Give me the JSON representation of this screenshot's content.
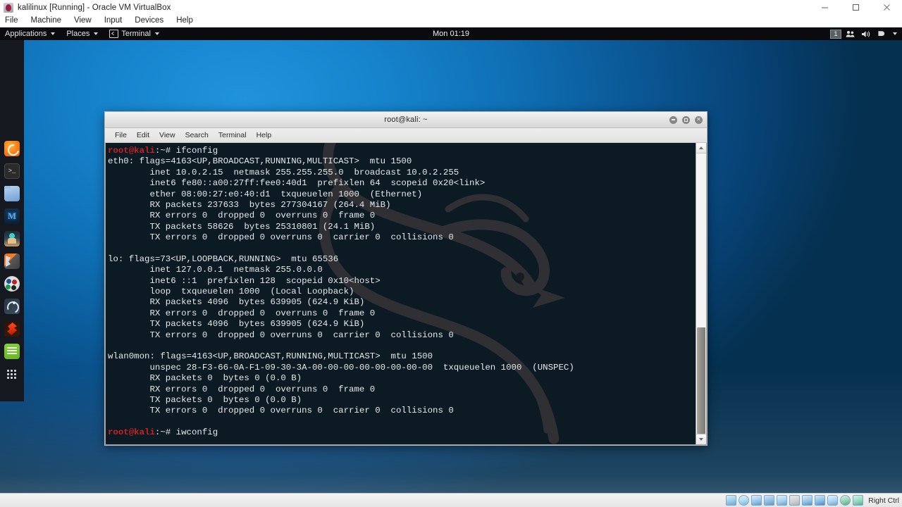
{
  "host_window": {
    "title": "kalilinux [Running] - Oracle VM VirtualBox",
    "app_icon": "virtualbox-icon",
    "controls": {
      "minimize": "minimize-icon",
      "maximize": "maximize-icon",
      "close": "close-icon"
    },
    "menu": [
      "File",
      "Machine",
      "View",
      "Input",
      "Devices",
      "Help"
    ]
  },
  "guest_panel": {
    "applications_label": "Applications",
    "places_label": "Places",
    "terminal_label": "Terminal",
    "clock": "Mon 01:19",
    "workspace": "1",
    "tray_icons": [
      "users-icon",
      "volume-icon",
      "power-icon",
      "chevron-down-icon"
    ]
  },
  "dock": {
    "items": [
      {
        "name": "firefox",
        "label": "Firefox ESR",
        "class": "di-firefox",
        "running": true
      },
      {
        "name": "terminal",
        "label": "Terminal",
        "class": "di-terminal",
        "running": true
      },
      {
        "name": "files",
        "label": "Files",
        "class": "di-files",
        "running": false
      },
      {
        "name": "metasploit",
        "label": "Metasploit Framework",
        "class": "di-metasploit",
        "running": false
      },
      {
        "name": "armitage",
        "label": "Armitage",
        "class": "di-armitage",
        "running": false
      },
      {
        "name": "burpsuite",
        "label": "Burp Suite",
        "class": "di-burp",
        "running": false
      },
      {
        "name": "beef",
        "label": "BeEF",
        "class": "di-beef",
        "running": false
      },
      {
        "name": "maltego",
        "label": "Maltego",
        "class": "di-maltego",
        "running": false
      },
      {
        "name": "faraday",
        "label": "Faraday IDE",
        "class": "di-flame",
        "running": false
      },
      {
        "name": "text-editor",
        "label": "Text Editor",
        "class": "di-notes",
        "running": false
      },
      {
        "name": "show-applications",
        "label": "Show Applications",
        "class": "di-apps",
        "running": false
      }
    ]
  },
  "terminal": {
    "title": "root@kali: ~",
    "menu": [
      "File",
      "Edit",
      "View",
      "Search",
      "Terminal",
      "Help"
    ],
    "window_buttons": [
      "minimize",
      "maximize",
      "close"
    ],
    "prompt_user": "root@kali",
    "prompt_sym": ":~# ",
    "lines": [
      {
        "type": "prompt",
        "command": "ifconfig"
      },
      {
        "type": "out",
        "text": "eth0: flags=4163<UP,BROADCAST,RUNNING,MULTICAST>  mtu 1500"
      },
      {
        "type": "out",
        "text": "        inet 10.0.2.15  netmask 255.255.255.0  broadcast 10.0.2.255"
      },
      {
        "type": "out",
        "text": "        inet6 fe80::a00:27ff:fee0:40d1  prefixlen 64  scopeid 0x20<link>"
      },
      {
        "type": "out",
        "text": "        ether 08:00:27:e0:40:d1  txqueuelen 1000  (Ethernet)"
      },
      {
        "type": "out",
        "text": "        RX packets 237633  bytes 277304167 (264.4 MiB)"
      },
      {
        "type": "out",
        "text": "        RX errors 0  dropped 0  overruns 0  frame 0"
      },
      {
        "type": "out",
        "text": "        TX packets 58626  bytes 25310801 (24.1 MiB)"
      },
      {
        "type": "out",
        "text": "        TX errors 0  dropped 0 overruns 0  carrier 0  collisions 0"
      },
      {
        "type": "out",
        "text": ""
      },
      {
        "type": "out",
        "text": "lo: flags=73<UP,LOOPBACK,RUNNING>  mtu 65536"
      },
      {
        "type": "out",
        "text": "        inet 127.0.0.1  netmask 255.0.0.0"
      },
      {
        "type": "out",
        "text": "        inet6 ::1  prefixlen 128  scopeid 0x10<host>"
      },
      {
        "type": "out",
        "text": "        loop  txqueuelen 1000  (Local Loopback)"
      },
      {
        "type": "out",
        "text": "        RX packets 4096  bytes 639905 (624.9 KiB)"
      },
      {
        "type": "out",
        "text": "        RX errors 0  dropped 0  overruns 0  frame 0"
      },
      {
        "type": "out",
        "text": "        TX packets 4096  bytes 639905 (624.9 KiB)"
      },
      {
        "type": "out",
        "text": "        TX errors 0  dropped 0 overruns 0  carrier 0  collisions 0"
      },
      {
        "type": "out",
        "text": ""
      },
      {
        "type": "out",
        "text": "wlan0mon: flags=4163<UP,BROADCAST,RUNNING,MULTICAST>  mtu 1500"
      },
      {
        "type": "out",
        "text": "        unspec 28-F3-66-0A-F1-09-30-3A-00-00-00-00-00-00-00-00  txqueuelen 1000  (UNSPEC)"
      },
      {
        "type": "out",
        "text": "        RX packets 0  bytes 0 (0.0 B)"
      },
      {
        "type": "out",
        "text": "        RX errors 0  dropped 0  overruns 0  frame 0"
      },
      {
        "type": "out",
        "text": "        TX packets 0  bytes 0 (0.0 B)"
      },
      {
        "type": "out",
        "text": "        TX errors 0  dropped 0 overruns 0  carrier 0  collisions 0"
      },
      {
        "type": "out",
        "text": ""
      },
      {
        "type": "prompt",
        "command": "iwconfig"
      }
    ]
  },
  "status_bar": {
    "host_key": "Right Ctrl",
    "icons": [
      "harddisk-icon",
      "optical-disk-icon",
      "floppy-icon",
      "network-icon",
      "usb-icon",
      "shared-folder-icon",
      "display-icon",
      "recording-icon",
      "virtualization-icon",
      "mouse-icon",
      "keyboard-icon"
    ]
  },
  "colors": {
    "desktop_light": "#2093dd",
    "desktop_dark": "#05304f",
    "terminal_bg": "#0c1a24",
    "terminal_fg": "#e6e9ea",
    "prompt_red": "#cc2222",
    "dragon": "#4a3937",
    "panel_bg": "#0b0b0d",
    "dock_bg": "#15191f"
  }
}
